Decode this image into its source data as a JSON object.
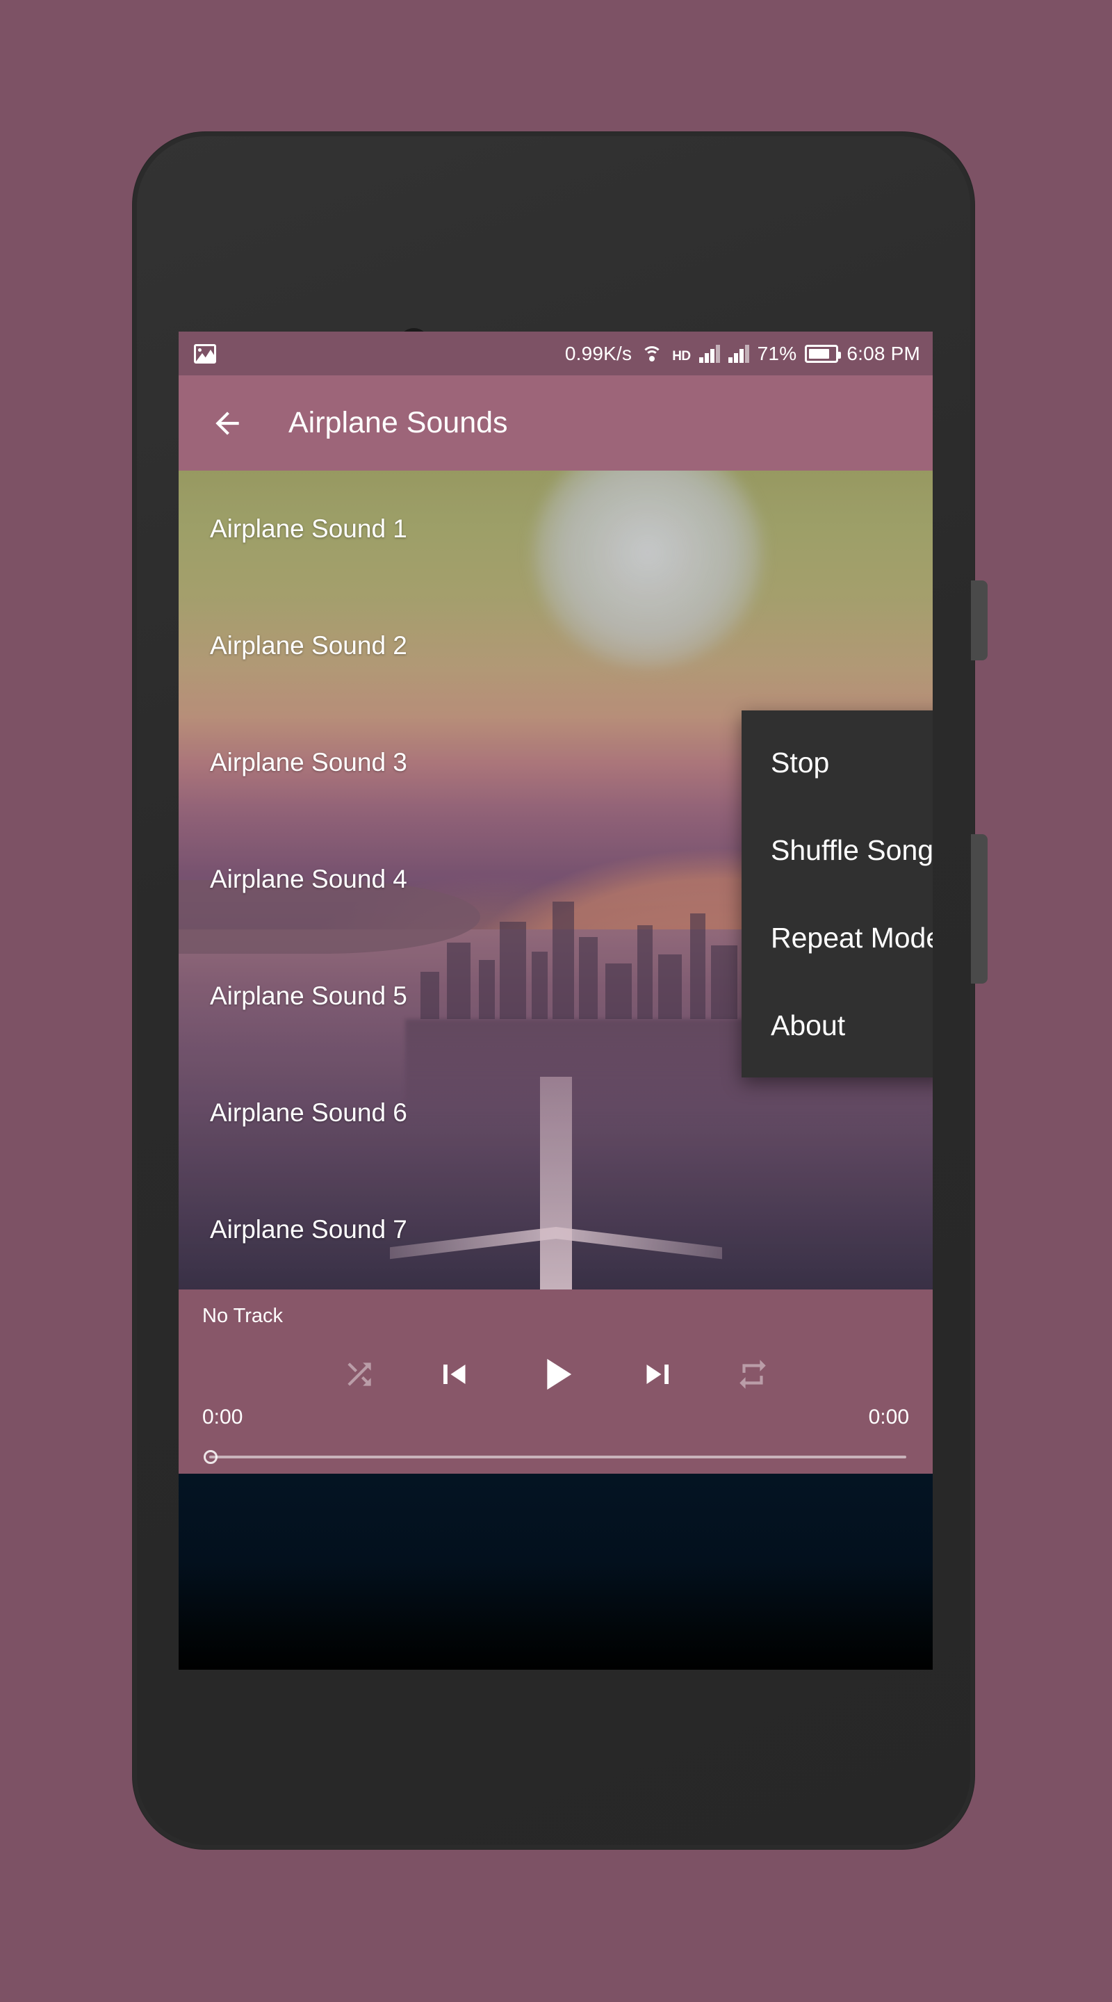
{
  "device": {
    "frame_color": "#2b2b2b",
    "page_background": "#7d5265"
  },
  "status_bar": {
    "left_icon": "image-icon",
    "network_speed": "0.99K/s",
    "wifi_icon": "wifi-icon",
    "volte_badge": "HD",
    "signal_1_icon": "signal-bars-icon",
    "signal_2_icon": "signal-bars-icon",
    "battery_percent": "71%",
    "battery_icon": "battery-icon",
    "clock": "6:08 PM",
    "background": "#7d5265"
  },
  "app_bar": {
    "back_icon": "arrow-left-icon",
    "title": "Airplane Sounds",
    "background": "#9d6579"
  },
  "song_list": {
    "items": [
      {
        "title": "Airplane Sound 1"
      },
      {
        "title": "Airplane Sound 2"
      },
      {
        "title": "Airplane Sound 3"
      },
      {
        "title": "Airplane Sound 4"
      },
      {
        "title": "Airplane Sound 5"
      },
      {
        "title": "Airplane Sound 6"
      },
      {
        "title": "Airplane Sound 7"
      }
    ]
  },
  "popup_menu": {
    "background": "#303030",
    "items": [
      {
        "label": "Stop",
        "has_submenu": false
      },
      {
        "label": "Shuffle Songs",
        "has_submenu": true
      },
      {
        "label": "Repeat Mode",
        "has_submenu": true
      },
      {
        "label": "About",
        "has_submenu": false
      }
    ]
  },
  "player": {
    "track_title": "No Track",
    "elapsed_time": "0:00",
    "total_time": "0:00",
    "shuffle_icon": "shuffle-icon",
    "previous_icon": "skip-previous-icon",
    "play_icon": "play-icon",
    "next_icon": "skip-next-icon",
    "repeat_icon": "repeat-icon",
    "shuffle_enabled": false,
    "repeat_enabled": false,
    "seek_progress": 0,
    "background": "#9b6378"
  }
}
